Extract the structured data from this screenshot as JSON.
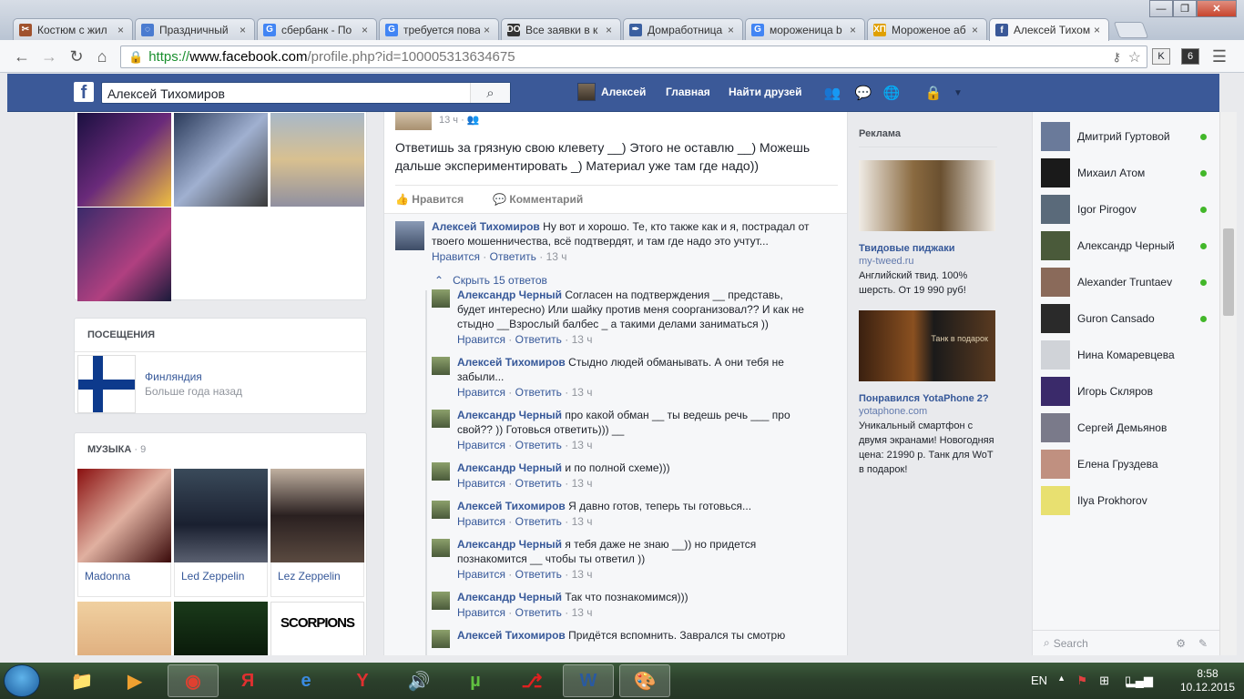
{
  "browser": {
    "tabs": [
      {
        "title": "Костюм с жил",
        "icon": "scissors-favicon",
        "color": "#a0522d",
        "glyph": "✂"
      },
      {
        "title": "Праздничный",
        "icon": "loading-favicon",
        "color": "#4a7bd0",
        "glyph": "◌"
      },
      {
        "title": "сбербанк - По",
        "icon": "google-favicon",
        "color": "#4285f4",
        "glyph": "G"
      },
      {
        "title": "требуется пова",
        "icon": "google-favicon",
        "color": "#4285f4",
        "glyph": "G"
      },
      {
        "title": "Все заявки в к",
        "icon": "do-favicon",
        "color": "#333333",
        "glyph": "DO"
      },
      {
        "title": "Домработница",
        "icon": "pen-favicon",
        "color": "#3a5fa0",
        "glyph": "✒"
      },
      {
        "title": "мороженица b",
        "icon": "google-favicon",
        "color": "#4285f4",
        "glyph": "G"
      },
      {
        "title": "Мороженое аб",
        "icon": "hp-favicon",
        "color": "#e0a000",
        "glyph": "ХП"
      },
      {
        "title": "Алексей Тихом",
        "icon": "facebook-favicon",
        "color": "#3b5998",
        "glyph": "f"
      }
    ],
    "url_https": "https://",
    "url_domain": "www.facebook.com",
    "url_rest": "/profile.php?id=100005313634675",
    "ext_badge": "6"
  },
  "fb": {
    "search_value": "Алексей Тихомиров",
    "user_name": "Алексей",
    "nav_home": "Главная",
    "nav_find_friends": "Найти друзей"
  },
  "left": {
    "visits_header": "ПОСЕЩЕНИЯ",
    "visit_place": "Финляндия",
    "visit_time": "Больше года назад",
    "music_header": "МУЗЫКА",
    "music_count": "· 9",
    "music": [
      "Madonna",
      "Led Zeppelin",
      "Lez Zeppelin"
    ],
    "music_row2_logo": "SCORPIONS"
  },
  "post": {
    "time": "13 ч ·",
    "text": "Ответишь за грязную свою клевету __) Этого не оставлю __) Можешь дальше экспериментировать _) Материал уже там где надо))",
    "like": "Нравится",
    "comment": "Комментарий",
    "top_comment": {
      "name": "Алексей Тихомиров",
      "text": "Ну вот и хорошо. Те, кто также как и я, пострадал от твоего мошенничества, всё подтвердят, и там где надо это учтут...",
      "like": "Нравится",
      "reply": "Ответить",
      "time": "13 ч"
    },
    "hide_replies": "Скрыть 15 ответов",
    "replies": [
      {
        "name": "Александр Черный",
        "text": "Согласен на подтверждения __ представь, будет интересно) Или шайку против меня соорганизовал?? И как не стыдно __Взрослый балбес _ а такими делами заниматься ))",
        "like": "Нравится",
        "reply": "Ответить",
        "time": "13 ч"
      },
      {
        "name": "Алексей Тихомиров",
        "text": "Стыдно людей обманывать. А они тебя не забыли...",
        "like": "Нравится",
        "reply": "Ответить",
        "time": "13 ч"
      },
      {
        "name": "Александр Черный",
        "text": "про какой обман __ ты ведешь речь ___ про свой?? )) Готовься ответить))) __",
        "like": "Нравится",
        "reply": "Ответить",
        "time": "13 ч"
      },
      {
        "name": "Александр Черный",
        "text": "и по полной схеме)))",
        "like": "Нравится",
        "reply": "Ответить",
        "time": "13 ч"
      },
      {
        "name": "Алексей Тихомиров",
        "text": "Я давно готов, теперь ты готовься...",
        "like": "Нравится",
        "reply": "Ответить",
        "time": "13 ч"
      },
      {
        "name": "Александр Черный",
        "text": "я тебя даже не знаю __)) но придется познакомится __ чтобы ты ответил ))",
        "like": "Нравится",
        "reply": "Ответить",
        "time": "13 ч"
      },
      {
        "name": "Александр Черный",
        "text": "Так что познакомимся)))",
        "like": "Нравится",
        "reply": "Ответить",
        "time": "13 ч"
      },
      {
        "name": "Алексей Тихомиров",
        "text": "Придётся вспомнить. Заврался ты смотрю",
        "like": "",
        "reply": "",
        "time": ""
      }
    ]
  },
  "ads": {
    "header": "Реклама",
    "items": [
      {
        "title": "Твидовые пиджаки",
        "url": "my-tweed.ru",
        "text": "Английский твид. 100% шерсть. От 19 990 руб!"
      },
      {
        "title": "Понравился YotaPhone 2?",
        "url": "yotaphone.com",
        "text": "Уникальный смартфон с двумя экранами! Новогодняя цена: 21990 р. Танк для WoT в подарок!",
        "img_caption": "Танк в подарок"
      }
    ]
  },
  "chat": {
    "friends": [
      {
        "name": "Дмитрий Гуртовой",
        "online": true,
        "color": "#6a7a9a"
      },
      {
        "name": "Михаил Атом",
        "online": true,
        "color": "#1a1a1a"
      },
      {
        "name": "Igor Pirogov",
        "online": true,
        "color": "#5a6a7a"
      },
      {
        "name": "Александр Черный",
        "online": true,
        "color": "#4a5a3a"
      },
      {
        "name": "Alexander Truntaev",
        "online": true,
        "color": "#8a6a5a"
      },
      {
        "name": "Guron Cansado",
        "online": true,
        "color": "#2a2a2a"
      },
      {
        "name": "Нина Комаревцева",
        "online": false,
        "color": "#d0d3d8"
      },
      {
        "name": "Игорь Скляров",
        "online": false,
        "color": "#3a2a6a"
      },
      {
        "name": "Сергей Демьянов",
        "online": false,
        "color": "#7a7a8a"
      },
      {
        "name": "Елена Груздева",
        "online": false,
        "color": "#c09080"
      },
      {
        "name": "Ilya Prokhorov",
        "online": false,
        "color": "#e8e070"
      }
    ],
    "search_placeholder": "Search"
  },
  "taskbar": {
    "lang": "EN",
    "time": "8:58",
    "date": "10.12.2015"
  }
}
